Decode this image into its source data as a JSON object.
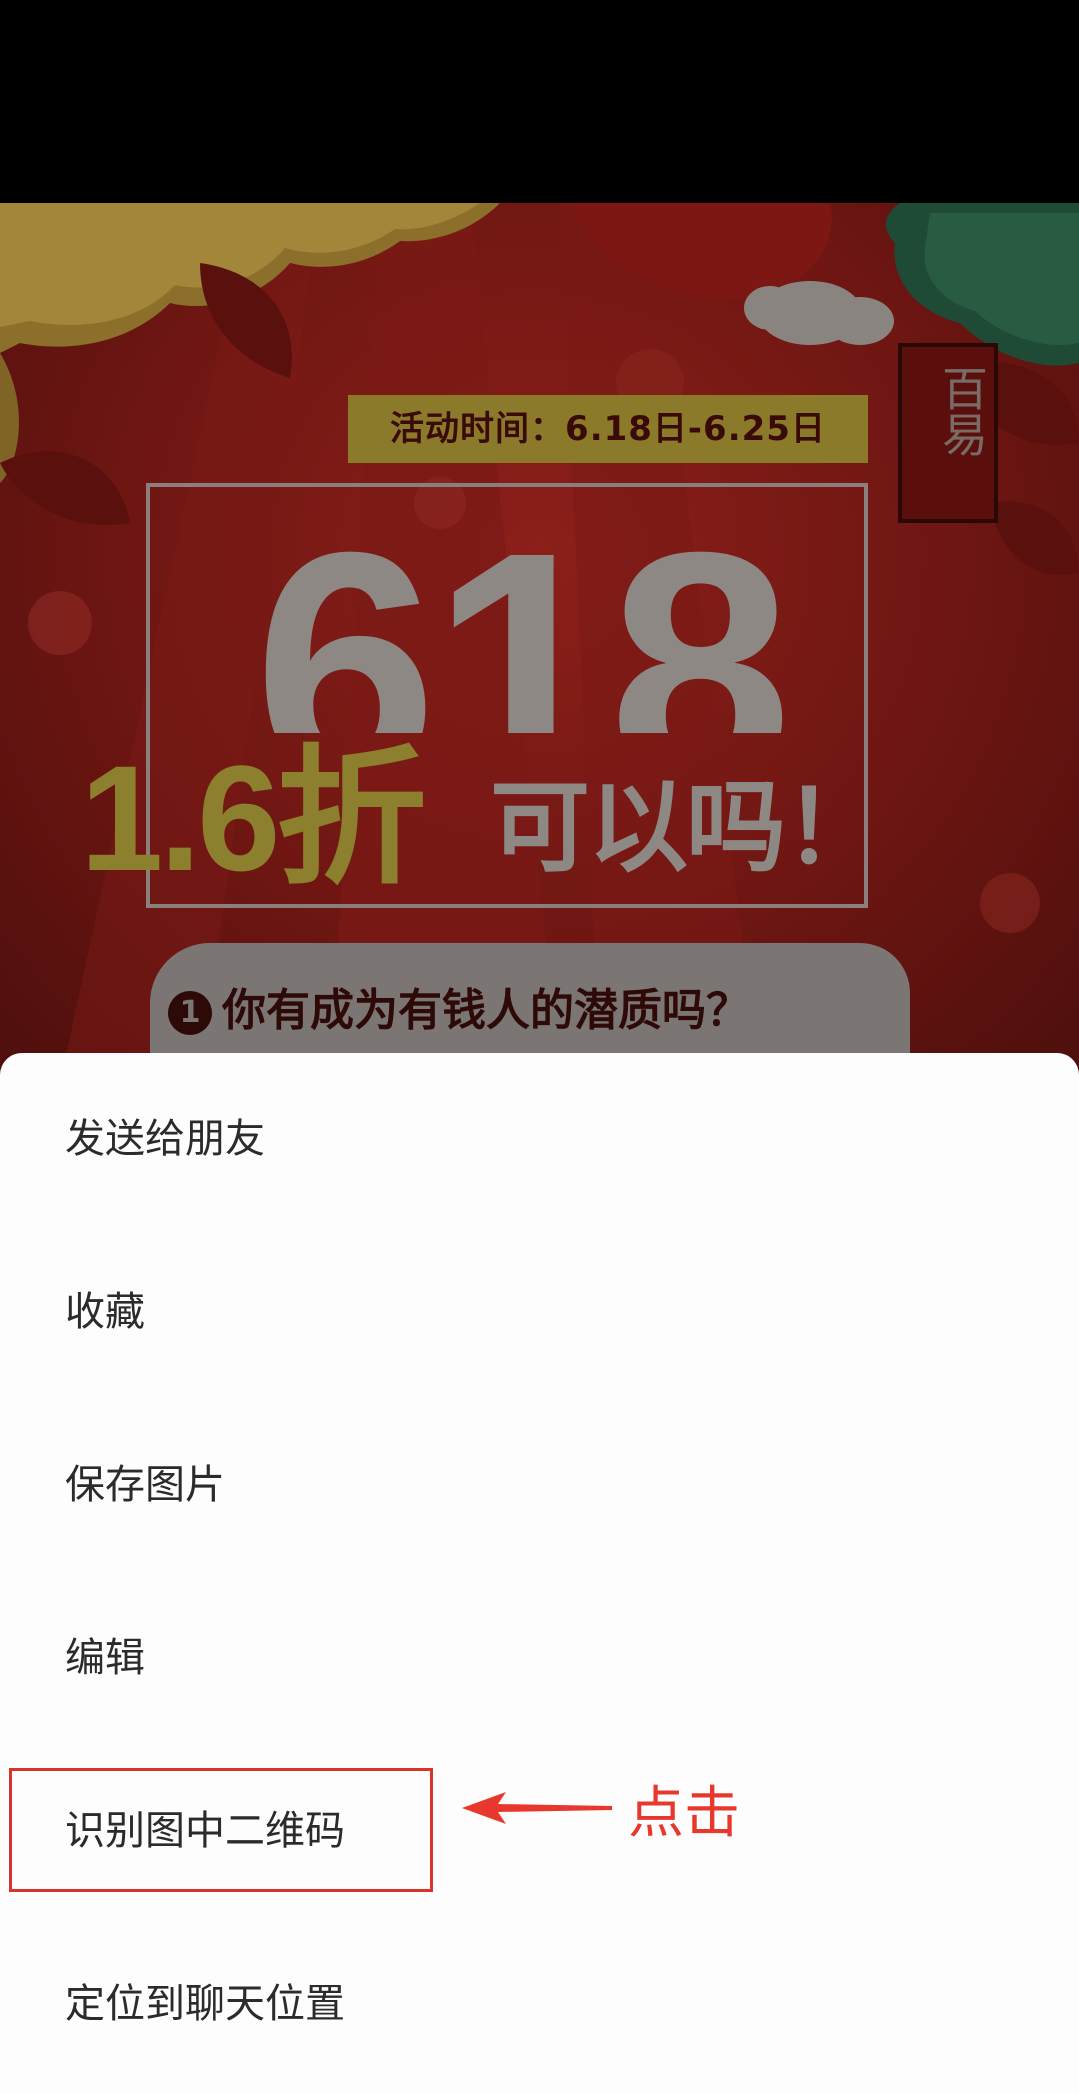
{
  "poster": {
    "event_time": "活动时间：6.18日-6.25日",
    "seal_text": "百易",
    "big_number": "618",
    "discount": "1.6折",
    "question_line": "可以吗！",
    "question_number": "1",
    "question_text": "你有成为有钱人的潜质吗？"
  },
  "menu": {
    "items": [
      {
        "label": "发送给朋友"
      },
      {
        "label": "收藏"
      },
      {
        "label": "保存图片"
      },
      {
        "label": "编辑"
      },
      {
        "label": "识别图中二维码"
      },
      {
        "label": "定位到聊天位置"
      }
    ]
  },
  "annotation": {
    "tap_label": "点击",
    "color": "#e8382d"
  }
}
